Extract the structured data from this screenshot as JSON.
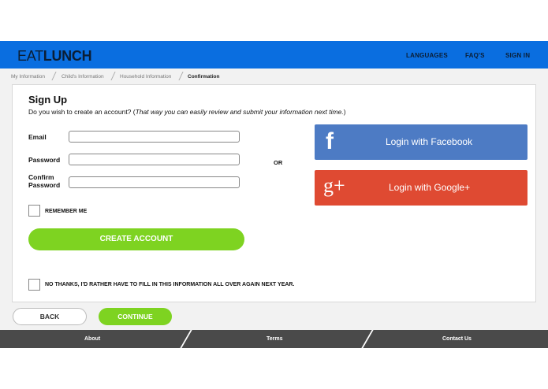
{
  "header": {
    "logo_thin": "EAT",
    "logo_bold": "LUNCH",
    "nav": [
      "LANGUAGES",
      "FAQ'S",
      "SIGN IN"
    ]
  },
  "breadcrumbs": [
    "My Information",
    "Child's Information",
    "Household Information",
    "Confirmation"
  ],
  "form": {
    "title": "Sign Up",
    "subtitle_plain": "Do you wish to create an account? (",
    "subtitle_italic": "That way you can easily review and submit your information next time.",
    "subtitle_end": ")",
    "email_label": "Email",
    "password_label": "Password",
    "confirm_label_1": "Confirm",
    "confirm_label_2": "Password",
    "or_text": "OR",
    "remember_label": "REMEMBER ME",
    "create_label": "CREATE ACCOUNT",
    "no_thanks_label": "NO THANKS, I'D RATHER HAVE TO FILL IN THIS INFORMATION ALL OVER AGAIN NEXT YEAR."
  },
  "social": {
    "facebook_label": "Login with Facebook",
    "google_label": "Login with Google+",
    "facebook_glyph": "f",
    "google_glyph": "g+"
  },
  "actions": {
    "back_label": "BACK",
    "continue_label": "CONTINUE"
  },
  "footer": {
    "links": [
      "About",
      "Terms",
      "Contact Us"
    ]
  },
  "colors": {
    "brand_blue": "#0a6ee0",
    "accent_green": "#7ed321",
    "facebook_blue": "#4d7bc4",
    "google_red": "#df4a32",
    "footer_gray": "#4a4a4a"
  }
}
